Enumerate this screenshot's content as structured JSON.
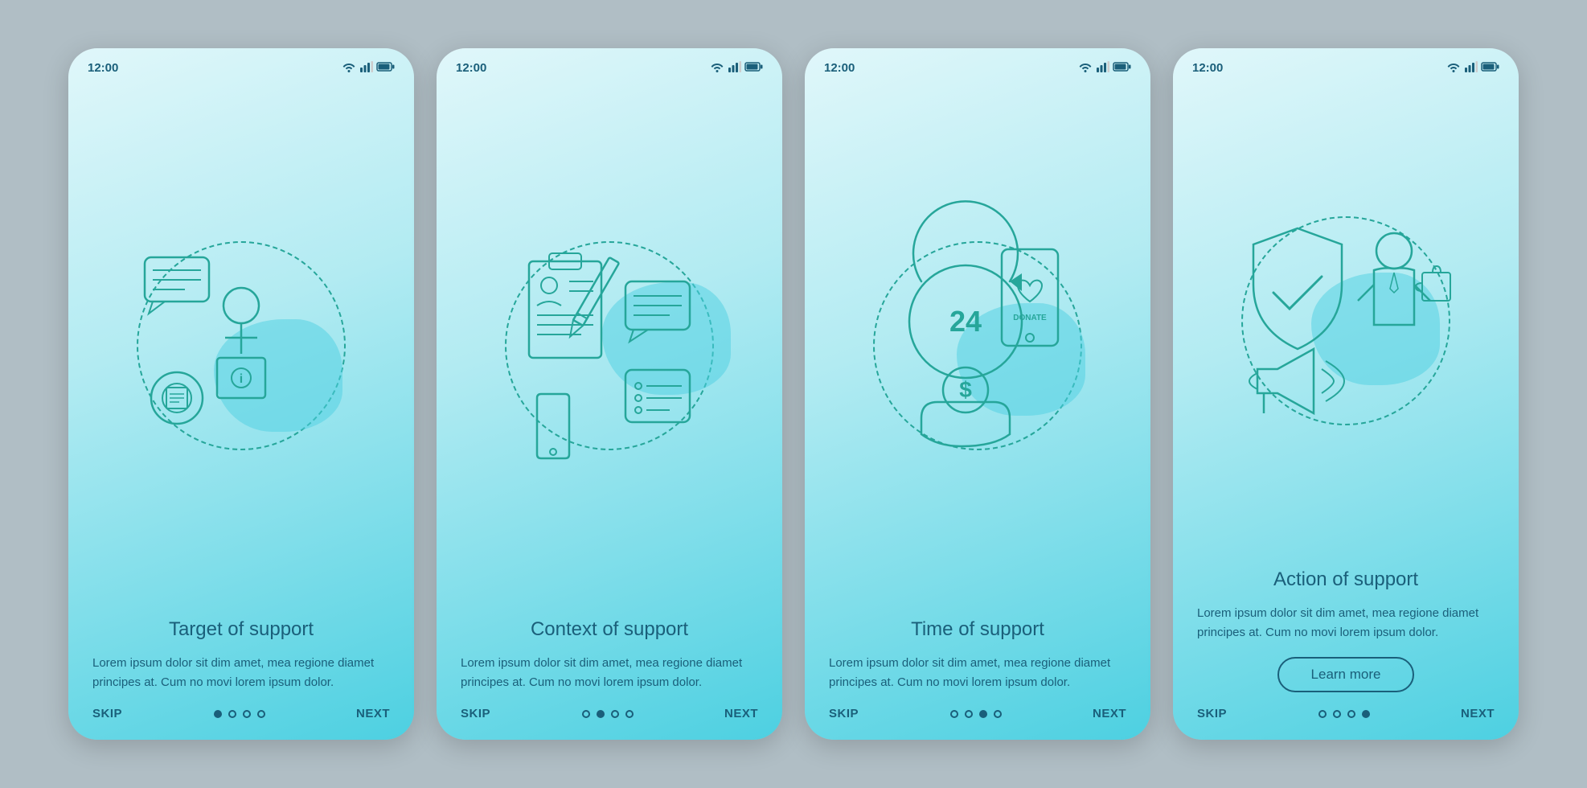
{
  "phones": [
    {
      "id": "phone-1",
      "status": {
        "time": "12:00"
      },
      "title": "Target of support",
      "body": "Lorem ipsum dolor sit dim amet, mea regione diamet principes at. Cum no movi lorem ipsum dolor.",
      "has_learn_more": false,
      "dots": [
        true,
        false,
        false,
        false
      ],
      "nav": {
        "skip": "SKIP",
        "next": "NEXT"
      }
    },
    {
      "id": "phone-2",
      "status": {
        "time": "12:00"
      },
      "title": "Context of support",
      "body": "Lorem ipsum dolor sit dim amet, mea regione diamet principes at. Cum no movi lorem ipsum dolor.",
      "has_learn_more": false,
      "dots": [
        false,
        true,
        false,
        false
      ],
      "nav": {
        "skip": "SKIP",
        "next": "NEXT"
      }
    },
    {
      "id": "phone-3",
      "status": {
        "time": "12:00"
      },
      "title": "Time of support",
      "body": "Lorem ipsum dolor sit dim amet, mea regione diamet principes at. Cum no movi lorem ipsum dolor.",
      "has_learn_more": false,
      "dots": [
        false,
        false,
        true,
        false
      ],
      "nav": {
        "skip": "SKIP",
        "next": "NEXT"
      }
    },
    {
      "id": "phone-4",
      "status": {
        "time": "12:00"
      },
      "title": "Action of support",
      "body": "Lorem ipsum dolor sit dim amet, mea regione diamet principes at. Cum no movi lorem ipsum dolor.",
      "has_learn_more": true,
      "learn_more_label": "Learn more",
      "dots": [
        false,
        false,
        false,
        true
      ],
      "nav": {
        "skip": "SKIP",
        "next": "NEXT"
      }
    }
  ]
}
